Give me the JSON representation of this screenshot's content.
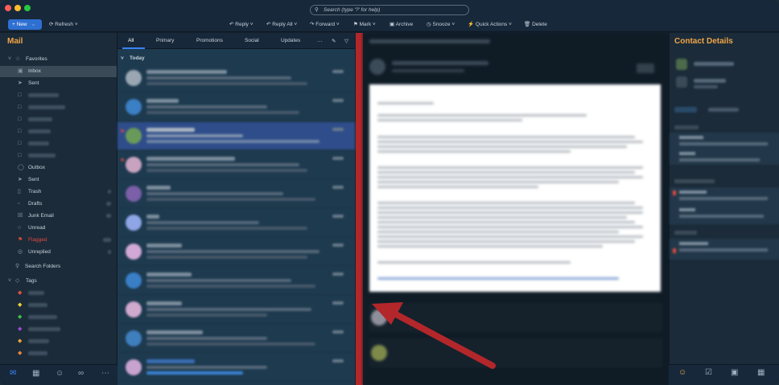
{
  "search": {
    "placeholder": "Search (type '?' for help)"
  },
  "toolbar": {
    "new_label": "New",
    "refresh_label": "Refresh",
    "reply_label": "Reply",
    "reply_all_label": "Reply All",
    "forward_label": "Forward",
    "mark_label": "Mark",
    "archive_label": "Archive",
    "snooze_label": "Snooze",
    "quick_actions_label": "Quick Actions",
    "delete_label": "Delete"
  },
  "sidebar": {
    "title": "Mail",
    "favorites_label": "Favorites",
    "inbox_label": "Inbox",
    "sent_label": "Sent",
    "outbox_label": "Outbox",
    "sent2_label": "Sent",
    "trash_label": "Trash",
    "drafts_label": "Drafts",
    "junk_label": "Junk Email",
    "unread_label": "Unread",
    "flagged_label": "Flagged",
    "unreplied_label": "Unreplied",
    "search_folders_label": "Search Folders",
    "tags_label": "Tags"
  },
  "list": {
    "tabs": [
      "All",
      "Primary",
      "Promotions",
      "Social",
      "Updates"
    ],
    "more_label": "…",
    "group_label": "Today"
  },
  "contact": {
    "title": "Contact Details"
  },
  "colors": {
    "accent_orange": "#f0a648",
    "accent_blue": "#2e6fd2",
    "annotation_red": "#b3272b",
    "flagged_red": "#e04a3f"
  }
}
